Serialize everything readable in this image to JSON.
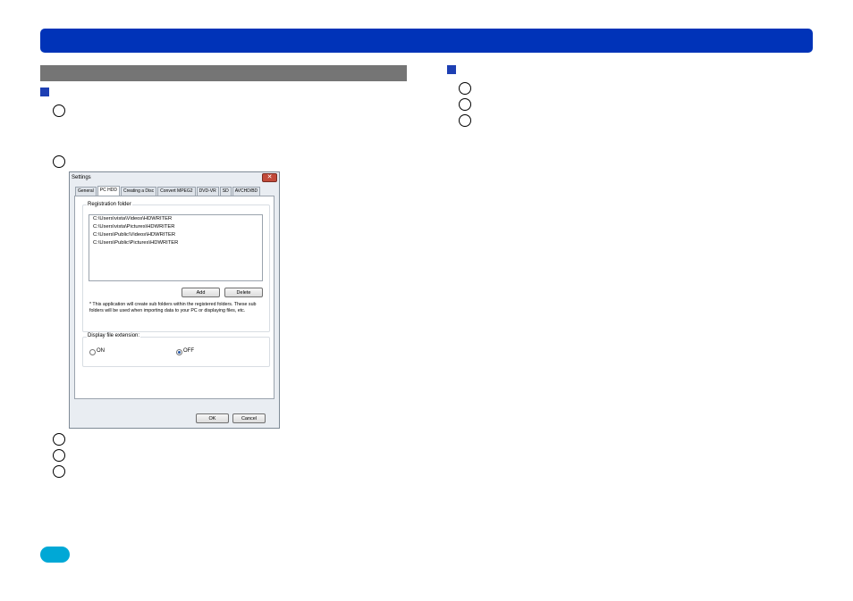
{
  "settings_dialog": {
    "title": "Settings",
    "close_glyph": "✕",
    "tabs": [
      "General",
      "PC HDD",
      "Creating a Disc",
      "Convert MPEG2",
      "DVD-VR",
      "SD",
      "AVCHD/BD"
    ],
    "active_tab": "PC HDD",
    "registration_folder_label": "Registration folder",
    "folders": [
      "C:\\Users\\vista\\Videos\\HDWRITER",
      "C:\\Users\\vista\\Pictures\\HDWRITER",
      "C:\\Users\\Public\\Videos\\HDWRITER",
      "C:\\Users\\Public\\Pictures\\HDWRITER"
    ],
    "add_label": "Add",
    "delete_label": "Delete",
    "note": "* This application will create sub folders within the registered folders. These sub folders will be used when importing data to your PC or displaying files, etc.",
    "display_ext_label": "Display file extension:",
    "on_label": "ON",
    "off_label": "OFF",
    "selected_option": "OFF",
    "ok_label": "OK",
    "cancel_label": "Cancel"
  },
  "colors": {
    "header_bar": "#0033b8",
    "section_bar": "#757575",
    "bullet": "#1d3fb3",
    "page_pill": "#00a8d6"
  }
}
